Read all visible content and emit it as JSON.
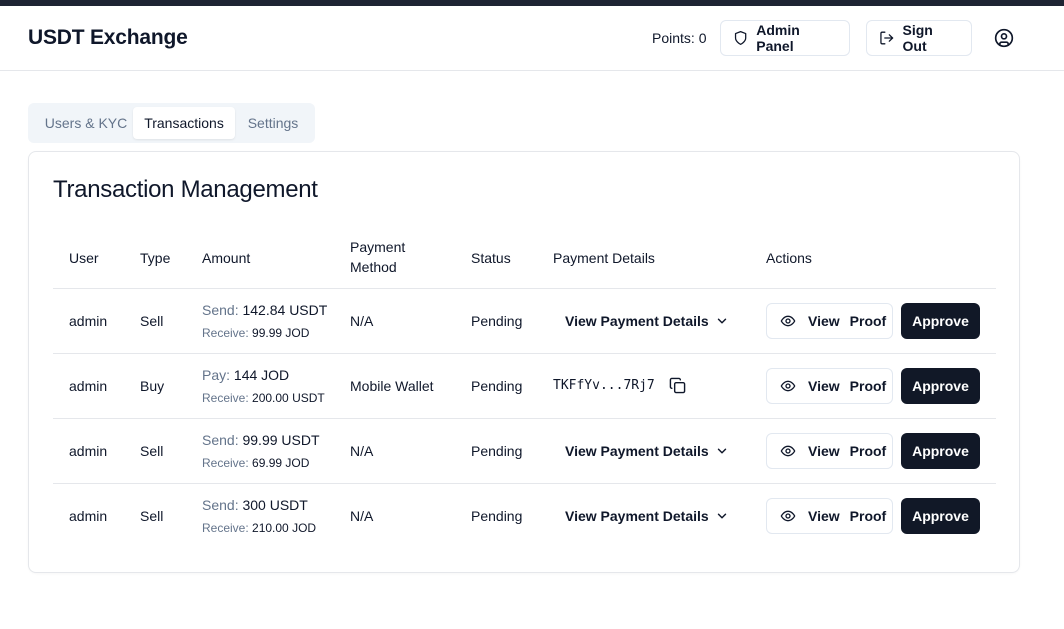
{
  "header": {
    "brand": "USDT Exchange",
    "points": "Points: 0",
    "admin_panel_label": "Admin Panel",
    "sign_out_label": "Sign Out"
  },
  "tabs": [
    {
      "label": "Users & KYC",
      "active": false
    },
    {
      "label": "Transactions",
      "active": true
    },
    {
      "label": "Settings",
      "active": false
    }
  ],
  "card": {
    "title": "Transaction Management"
  },
  "table": {
    "columns": {
      "user": "User",
      "type": "Type",
      "amount": "Amount",
      "payment_method_1": "Payment",
      "payment_method_2": "Method",
      "status": "Status",
      "payment_details": "Payment Details",
      "actions": "Actions"
    },
    "rows": [
      {
        "user": "admin",
        "type": "Sell",
        "amount_label": "Send:",
        "amount_value": "142.84 USDT",
        "receive_label": "Receive:",
        "receive_value": "99.99 JOD",
        "payment_method": "N/A",
        "status": "Pending",
        "details": "View Payment Details",
        "proof_w1": "View",
        "proof_w2": "Proof",
        "approve": "Approve"
      },
      {
        "user": "admin",
        "type": "Buy",
        "amount_label": "Pay:",
        "amount_value": "144 JOD",
        "receive_label": "Receive:",
        "receive_value": "200.00 USDT",
        "payment_method": "Mobile Wallet",
        "status": "Pending",
        "details": "TKFfYv...7Rj7",
        "proof_w1": "View",
        "proof_w2": "Proof",
        "approve": "Approve"
      },
      {
        "user": "admin",
        "type": "Sell",
        "amount_label": "Send:",
        "amount_value": "99.99 USDT",
        "receive_label": "Receive:",
        "receive_value": "69.99 JOD",
        "payment_method": "N/A",
        "status": "Pending",
        "details": "View Payment Details",
        "proof_w1": "View",
        "proof_w2": "Proof",
        "approve": "Approve"
      },
      {
        "user": "admin",
        "type": "Sell",
        "amount_label": "Send:",
        "amount_value": "300 USDT",
        "receive_label": "Receive:",
        "receive_value": "210.00 JOD",
        "payment_method": "N/A",
        "status": "Pending",
        "details": "View Payment Details",
        "proof_w1": "View",
        "proof_w2": "Proof",
        "approve": "Approve"
      }
    ]
  },
  "icons": {
    "admin_panel": "shield-icon",
    "sign_out": "log-out-icon",
    "user_menu": "user-circle-icon",
    "proof": "eye-icon",
    "details": "chevron-down-icon",
    "copy": "copy-icon"
  },
  "colors": {
    "primary_button": "#111827",
    "muted_text": "#64748b",
    "tab_bg": "#f1f5f9",
    "border": "#e5e7eb"
  }
}
